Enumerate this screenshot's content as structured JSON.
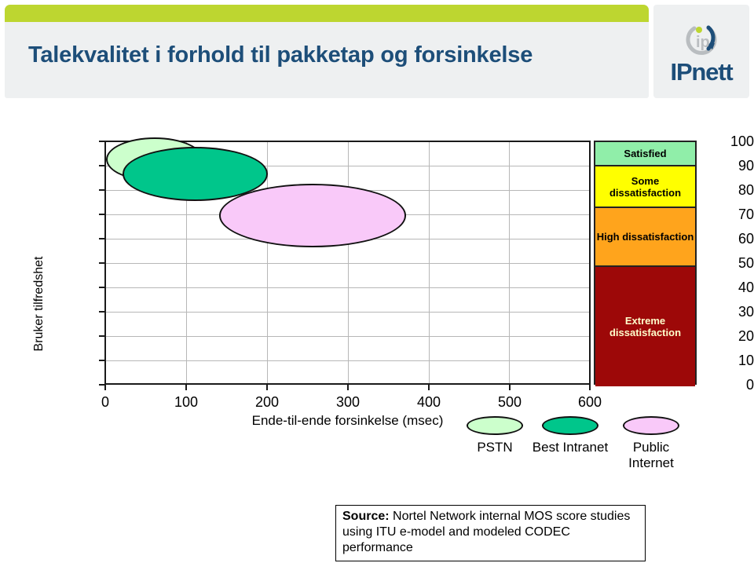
{
  "header": {
    "title": "Talekvalitet i forhold til pakketap og forsinkelse",
    "logo_word": "IPnett",
    "accent_green": "#bdd630",
    "title_blue": "#1d4e79",
    "panel_bg": "#eef0f1"
  },
  "chart_data": {
    "type": "scatter",
    "title": "Talekvalitet i forhold til pakketap og forsinkelse",
    "xlabel": "Ende-til-ende forsinkelse (msec)",
    "ylabel": "Bruker tilfredshet",
    "xlim": [
      0,
      600
    ],
    "ylim": [
      0,
      100
    ],
    "xticks": [
      "0",
      "100",
      "200",
      "300",
      "400",
      "500",
      "600"
    ],
    "yticks": [
      "100",
      "90",
      "80",
      "70",
      "60",
      "50",
      "40",
      "30",
      "20",
      "10",
      "0"
    ],
    "grid": true,
    "legend_position": "bottom",
    "series": [
      {
        "name": "PSTN",
        "color": "#ccffcc",
        "x_center": 60,
        "y_center": 93,
        "x_radius": 60,
        "y_radius": 9
      },
      {
        "name": "Best Intranet",
        "color": "#00c68b",
        "x_center": 110,
        "y_center": 87,
        "x_radius": 90,
        "y_radius": 11
      },
      {
        "name": "Public Internet",
        "color": "#f9c9f9",
        "x_center": 255,
        "y_center": 70,
        "x_radius": 115,
        "y_radius": 13
      }
    ]
  },
  "bands": {
    "items": [
      {
        "label": "Satisfied",
        "color": "#90eea9",
        "text_color": "#000000",
        "y_top": 100,
        "y_bottom": 90
      },
      {
        "label": "Some dissatisfaction",
        "color": "#ffff00",
        "text_color": "#000000",
        "y_top": 90,
        "y_bottom": 73
      },
      {
        "label": "High dissatisfaction",
        "color": "#ffa41c",
        "text_color": "#000000",
        "y_top": 73,
        "y_bottom": 49
      },
      {
        "label": "Extreme dissatisfaction",
        "color": "#9d0808",
        "text_color": "#ffffcc",
        "y_top": 49,
        "y_bottom": 0
      }
    ]
  },
  "legend": {
    "items": [
      {
        "label": "PSTN",
        "color": "#ccffcc"
      },
      {
        "label": "Best Intranet",
        "color": "#00c68b"
      },
      {
        "label": "Public Internet",
        "color": "#f9c9f9"
      }
    ]
  },
  "source": {
    "label": "Source:",
    "text": " Nortel Network internal MOS score studies using ITU e-model and modeled CODEC performance"
  }
}
